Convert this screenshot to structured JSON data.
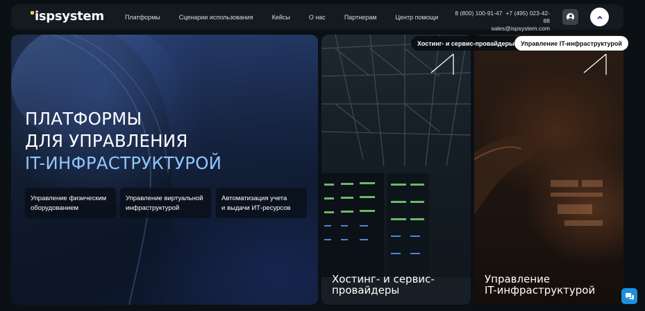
{
  "brand": {
    "logo_text": "ispsystem",
    "accent_color": "#f2c94c"
  },
  "nav": {
    "items": [
      {
        "label": "Платформы"
      },
      {
        "label": "Сценарии использования"
      },
      {
        "label": "Кейсы"
      },
      {
        "label": "О нас"
      },
      {
        "label": "Партнерам"
      },
      {
        "label": "Центр помощи"
      }
    ]
  },
  "contacts": {
    "phone1": "8 (800) 100-91-47",
    "phone2": "+7 (495) 023-42-88",
    "email": "sales@ispsystem.com"
  },
  "header_icons": {
    "user": "user-icon",
    "scroll_up": "chevron-up-icon"
  },
  "hero": {
    "title_line1": "ПЛАТФОРМЫ",
    "title_line2": "ДЛЯ УПРАВЛЕНИЯ",
    "title_line3": "IT-ИНФРАСТРУКТУРОЙ",
    "accent_color": "#8fc6ff",
    "features": [
      {
        "line1": "Управление физическим",
        "line2": "оборудованием"
      },
      {
        "line1": "Управление виртуальной",
        "line2": "инфраструктурой"
      },
      {
        "line1": "Автоматизация учета",
        "line2": "и выдачи ИТ-ресурсов"
      }
    ]
  },
  "tabs": {
    "hosting": "Хостинг- и сервис-провайдеры",
    "it": "Управление IT-инфраструктурой",
    "active": "it"
  },
  "cards": {
    "hosting": {
      "line1": "Хостинг- и сервис-",
      "line2": "провайдеры"
    },
    "it": {
      "line1": "Управление",
      "line2": "IT-инфраструктурой"
    }
  },
  "chat": {
    "icon": "chat-icon",
    "color": "#1b8fe0"
  }
}
